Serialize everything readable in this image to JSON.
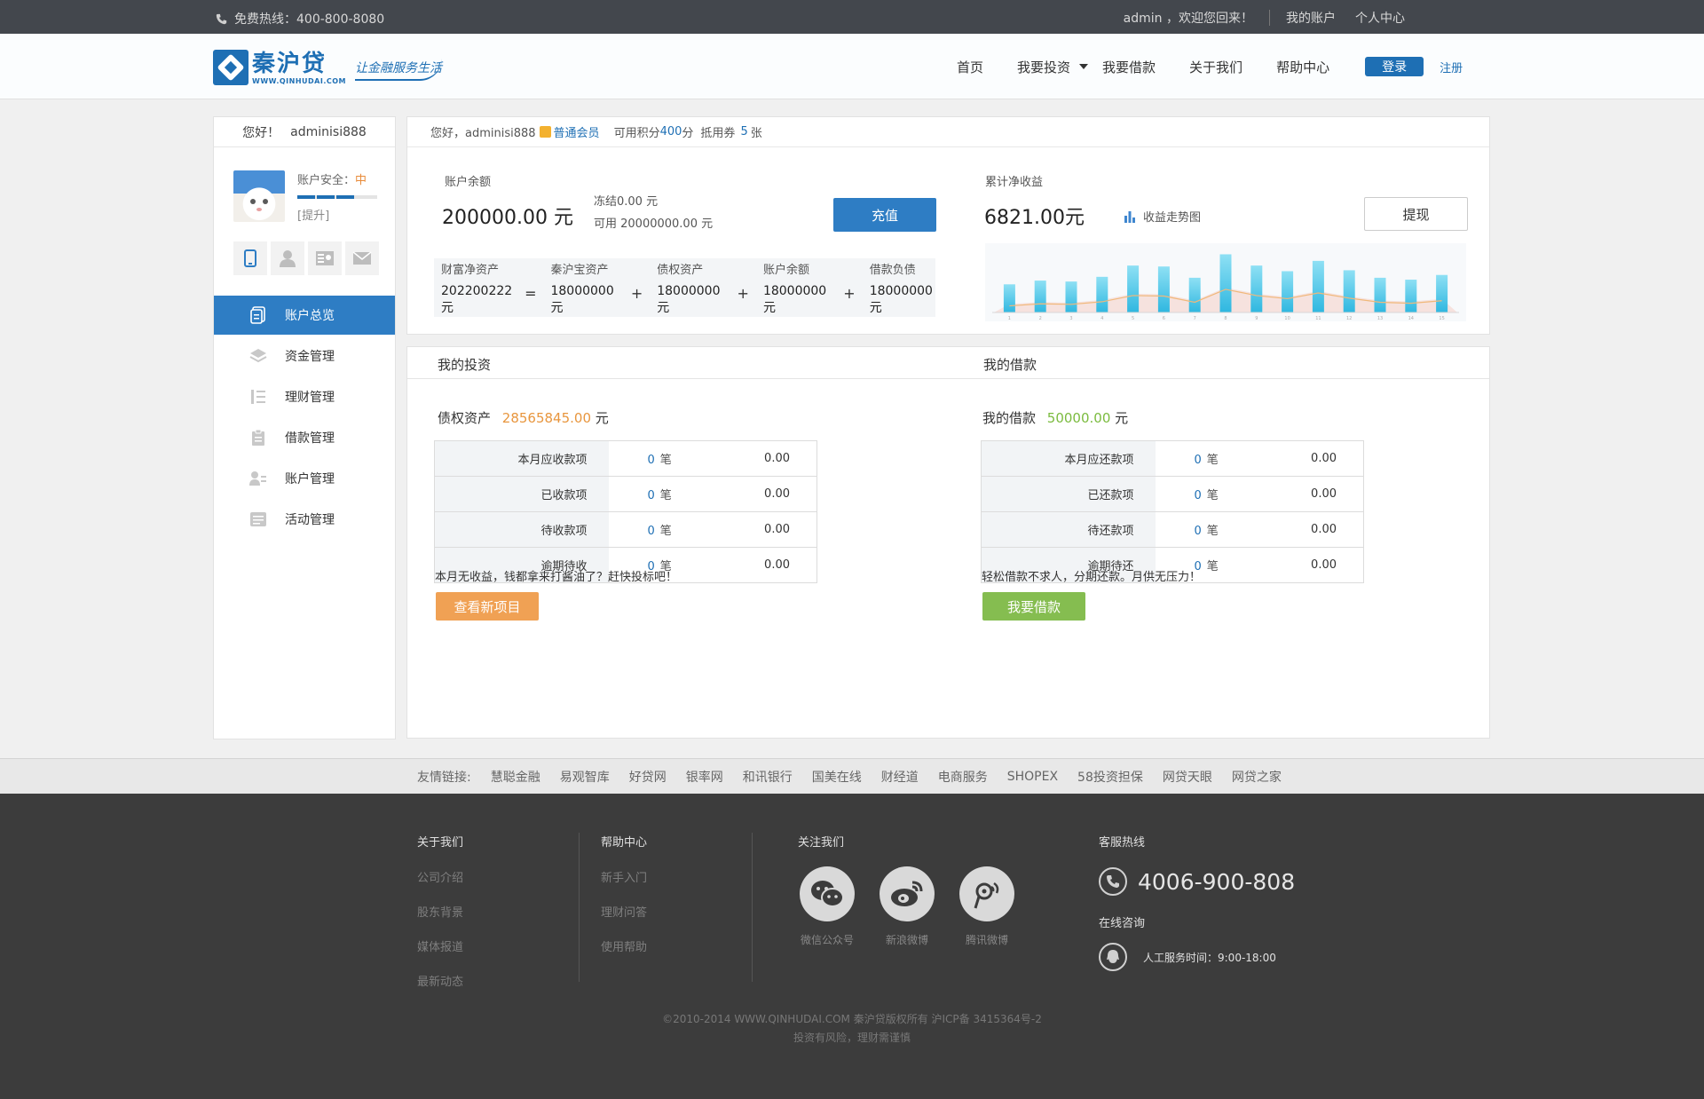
{
  "topbar": {
    "hotline": "免费热线：400-800-8080",
    "welcome": "admin ，欢迎您回来！",
    "my_account": "我的账户",
    "personal_center": "个人中心"
  },
  "header": {
    "logo_cn": "秦沪贷",
    "logo_en": "WWW.QINHUDAI.COM",
    "logo_slogan": "让金融服务生活",
    "nav": {
      "home": "首页",
      "invest": "我要投资",
      "borrow": "我要借款",
      "about": "关于我们",
      "help": "帮助中心",
      "login": "登录",
      "register": "注册"
    }
  },
  "sidebar": {
    "hello": "您好！",
    "username": "adminisi888",
    "security_label": "账户安全：",
    "security_level": "中",
    "security_bars": 0.6,
    "upgrade": "[提升]",
    "menu": [
      {
        "label": "账户总览",
        "active": true
      },
      {
        "label": "资金管理"
      },
      {
        "label": "理财管理"
      },
      {
        "label": "借款管理"
      },
      {
        "label": "账户管理"
      },
      {
        "label": "活动管理"
      }
    ]
  },
  "overview": {
    "greeting": "您好，adminisi888",
    "member_level": "普通会员",
    "points_label": "可用积分",
    "points": "400",
    "points_unit": "分",
    "coupon_label": "抵用券",
    "coupon_count": "5",
    "coupon_unit": "张",
    "balance_label": "账户余额",
    "balance_value": "200000.00 元",
    "frozen": "冻结0.00 元",
    "available": "可用 20000000.00 元",
    "recharge": "充值",
    "net_income_label": "累计净收益",
    "net_income_value": "6821.00元",
    "trend_label": "收益走势图",
    "withdraw": "提现",
    "assets": [
      {
        "label": "财富净资产",
        "value": "202200222元"
      },
      {
        "label": "秦沪宝资产",
        "value": "18000000元"
      },
      {
        "label": "债权资产",
        "value": "18000000元"
      },
      {
        "label": "账户余额",
        "value": "18000000元"
      },
      {
        "label": "借款负债",
        "value": "18000000元"
      }
    ],
    "ops": [
      "=",
      "+",
      "+",
      "+"
    ]
  },
  "chart_data": {
    "type": "bar",
    "categories": [
      "1",
      "2",
      "3",
      "4",
      "5",
      "6",
      "7",
      "8",
      "9",
      "10",
      "11",
      "12",
      "13",
      "14",
      "15"
    ],
    "series": [
      {
        "values": [
          30,
          34,
          33,
          38,
          50,
          49,
          37,
          62,
          50,
          44,
          55,
          45,
          37,
          35,
          40
        ]
      }
    ],
    "ylim": [
      0,
      70
    ],
    "grid": false
  },
  "invest": {
    "tab": "我的投资",
    "sum_label": "债权资产",
    "sum_value": "28565845.00",
    "sum_unit": "元",
    "rows": [
      {
        "label": "本月应收款项",
        "count": "0",
        "unit": "笔",
        "amount": "0.00"
      },
      {
        "label": "已收款项",
        "count": "0",
        "unit": "笔",
        "amount": "0.00"
      },
      {
        "label": "待收款项",
        "count": "0",
        "unit": "笔",
        "amount": "0.00"
      },
      {
        "label": "逾期待收",
        "count": "0",
        "unit": "笔",
        "amount": "0.00"
      }
    ],
    "tip": "本月无收益，钱都拿来打酱油了？赶快投标吧！",
    "button": "查看新项目"
  },
  "loan": {
    "tab": "我的借款",
    "sum_label": "我的借款",
    "sum_value": "50000.00",
    "sum_unit": "元",
    "rows": [
      {
        "label": "本月应还款项",
        "count": "0",
        "unit": "笔",
        "amount": "0.00"
      },
      {
        "label": "已还款项",
        "count": "0",
        "unit": "笔",
        "amount": "0.00"
      },
      {
        "label": "待还款项",
        "count": "0",
        "unit": "笔",
        "amount": "0.00"
      },
      {
        "label": "逾期待还",
        "count": "0",
        "unit": "笔",
        "amount": "0.00"
      }
    ],
    "tip": "轻松借款不求人，分期还款。月供无压力！",
    "button": "我要借款"
  },
  "friends": {
    "label": "友情链接:",
    "links": [
      "慧聪金融",
      "易观智库",
      "好贷网",
      "银率网",
      "和讯银行",
      "国美在线",
      "财经道",
      "电商服务",
      "SHOPEX",
      "58投资担保",
      "网贷天眼",
      "网贷之家"
    ]
  },
  "footer": {
    "about_title": "关于我们",
    "about_links": [
      "公司介绍",
      "股东背景",
      "媒体报道",
      "最新动态"
    ],
    "help_title": "帮助中心",
    "help_links": [
      "新手入门",
      "理财问答",
      "使用帮助"
    ],
    "follow_title": "关注我们",
    "social": [
      "微信公众号",
      "新浪微博",
      "腾讯微博"
    ],
    "service_title": "客服热线",
    "service_phone": "4006-900-808",
    "online_title": "在线咨询",
    "service_hours": "人工服务时间：9:00-18:00",
    "copyright": "©2010-2014 WWW.QINHUDAI.COM 秦沪贷版权所有 沪ICP备 3415364号-2",
    "risk": "投资有风险，理财需谨慎"
  },
  "colors": {
    "brand_blue": "#1e6fb4",
    "orange": "#e8963e",
    "green": "#7bbb3f"
  }
}
